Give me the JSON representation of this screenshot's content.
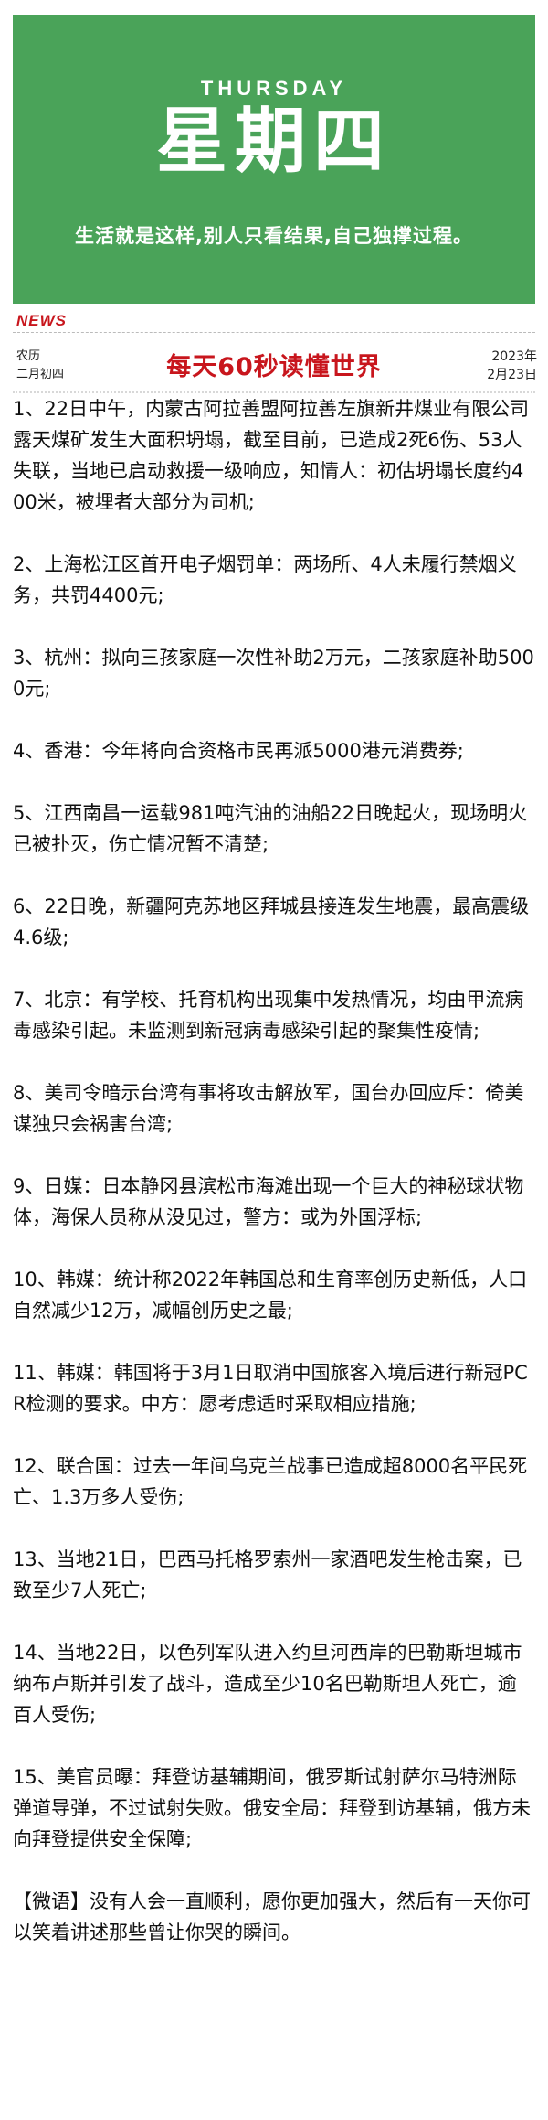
{
  "banner": {
    "day_en": "THURSDAY",
    "day_cn": "星期四",
    "motto": "生活就是这样,别人只看结果,自己独撑过程。",
    "color": "#4aa359"
  },
  "news_tag": "NEWS",
  "date": {
    "lunar_line1": "农历",
    "lunar_line2": "二月初四",
    "greg_line1": "2023年",
    "greg_line2": "2月23日"
  },
  "headline": "每天60秒读懂世界",
  "accent_color": "#c8161d",
  "items": [
    "1、22日中午，内蒙古阿拉善盟阿拉善左旗新井煤业有限公司露天煤矿发生大面积坍塌，截至目前，已造成2死6伤、53人失联，当地已启动救援一级响应，知情人：初估坍塌长度约400米，被埋者大部分为司机;",
    "2、上海松江区首开电子烟罚单：两场所、4人未履行禁烟义务，共罚4400元;",
    "3、杭州：拟向三孩家庭一次性补助2万元，二孩家庭补助5000元;",
    "4、香港：今年将向合资格市民再派5000港元消费券;",
    "5、江西南昌一运载981吨汽油的油船22日晚起火，现场明火已被扑灭，伤亡情况暂不清楚;",
    "6、22日晚，新疆阿克苏地区拜城县接连发生地震，最高震级4.6级;",
    "7、北京：有学校、托育机构出现集中发热情况，均由甲流病毒感染引起。未监测到新冠病毒感染引起的聚集性疫情;",
    "8、美司令暗示台湾有事将攻击解放军，国台办回应斥：倚美谋独只会祸害台湾;",
    "9、日媒：日本静冈县滨松市海滩出现一个巨大的神秘球状物体，海保人员称从没见过，警方：或为外国浮标;",
    "10、韩媒：统计称2022年韩国总和生育率创历史新低，人口自然减少12万，减幅创历史之最;",
    "11、韩媒：韩国将于3月1日取消中国旅客入境后进行新冠PCR检测的要求。中方：愿考虑适时采取相应措施;",
    "12、联合国：过去一年间乌克兰战事已造成超8000名平民死亡、1.3万多人受伤;",
    "13、当地21日，巴西马托格罗索州一家酒吧发生枪击案，已致至少7人死亡;",
    "14、当地22日，以色列军队进入约旦河西岸的巴勒斯坦城市纳布卢斯并引发了战斗，造成至少10名巴勒斯坦人死亡，逾百人受伤;",
    "15、美官员曝：拜登访基辅期间，俄罗斯试射萨尔马特洲际弹道导弹，不过试射失败。俄安全局：拜登到访基辅，俄方未向拜登提供安全保障;"
  ],
  "weiyu": "【微语】没有人会一直顺利，愿你更加强大，然后有一天你可以笑着讲述那些曾让你哭的瞬间。"
}
